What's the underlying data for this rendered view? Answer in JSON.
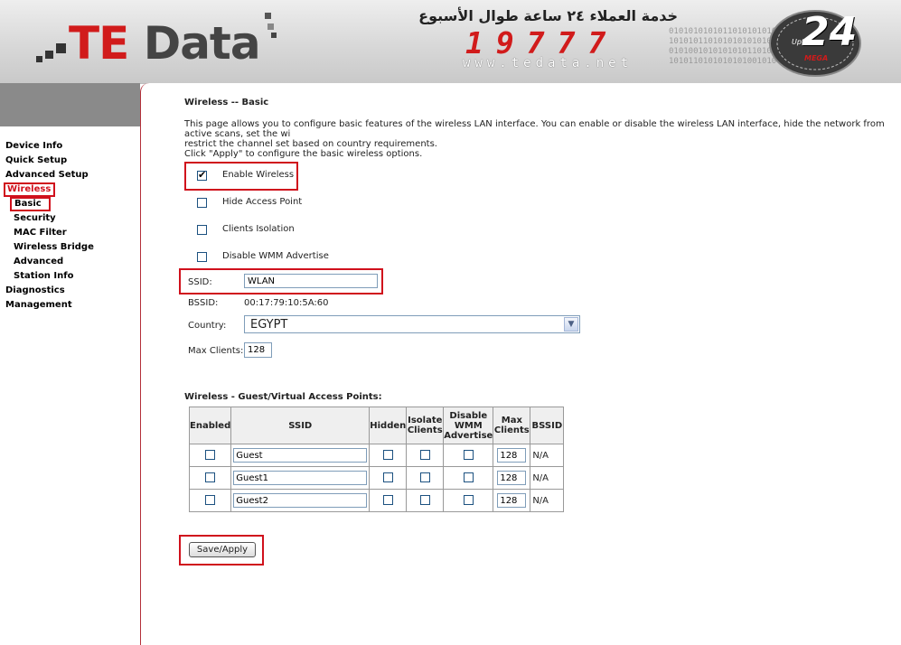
{
  "header": {
    "logo_te": "TE",
    "logo_data": "Data",
    "arabic_tagline": "خدمة العملاء ٢٤ ساعة طوال الأسبوع",
    "hotline": "19777",
    "website": "www.tedata.net",
    "badge_number": "24",
    "badge_small": "Upto",
    "badge_mega": "MEGA"
  },
  "sidebar": {
    "items": [
      {
        "label": "Device Info"
      },
      {
        "label": "Quick Setup"
      },
      {
        "label": "Advanced Setup"
      },
      {
        "label": "Wireless"
      },
      {
        "label": "Basic"
      },
      {
        "label": "Security"
      },
      {
        "label": "MAC Filter"
      },
      {
        "label": "Wireless Bridge"
      },
      {
        "label": "Advanced"
      },
      {
        "label": "Station Info"
      },
      {
        "label": "Diagnostics"
      },
      {
        "label": "Management"
      }
    ]
  },
  "main": {
    "title": "Wireless -- Basic",
    "description": "This page allows you to configure basic features of the wireless LAN interface. You can enable or disable the wireless LAN interface, hide the network from active scans, set the wi\nrestrict the channel set based on country requirements.\nClick \"Apply\" to configure the basic wireless options.",
    "enable_wireless": "Enable Wireless",
    "hide_ap": "Hide Access Point",
    "clients_isolation": "Clients Isolation",
    "disable_wmm": "Disable WMM Advertise",
    "ssid_label": "SSID:",
    "ssid_value": "WLAN",
    "bssid_label": "BSSID:",
    "bssid_value": "00:17:79:10:5A:60",
    "country_label": "Country:",
    "country_value": "EGYPT",
    "max_clients_label": "Max Clients:",
    "max_clients_value": "128",
    "guest_title": "Wireless - Guest/Virtual Access Points:",
    "guest_headers": {
      "enabled": "Enabled",
      "ssid": "SSID",
      "hidden": "Hidden",
      "isolate": "Isolate\nClients",
      "wmm": "Disable\nWMM\nAdvertise",
      "max": "Max\nClients",
      "bssid": "BSSID"
    },
    "guest_rows": [
      {
        "ssid": "Guest",
        "max": "128",
        "bssid": "N/A"
      },
      {
        "ssid": "Guest1",
        "max": "128",
        "bssid": "N/A"
      },
      {
        "ssid": "Guest2",
        "max": "128",
        "bssid": "N/A"
      }
    ],
    "save_button": "Save/Apply"
  },
  "colors": {
    "brand_red": "#d11b1b",
    "highlight_red": "#d0101c"
  }
}
